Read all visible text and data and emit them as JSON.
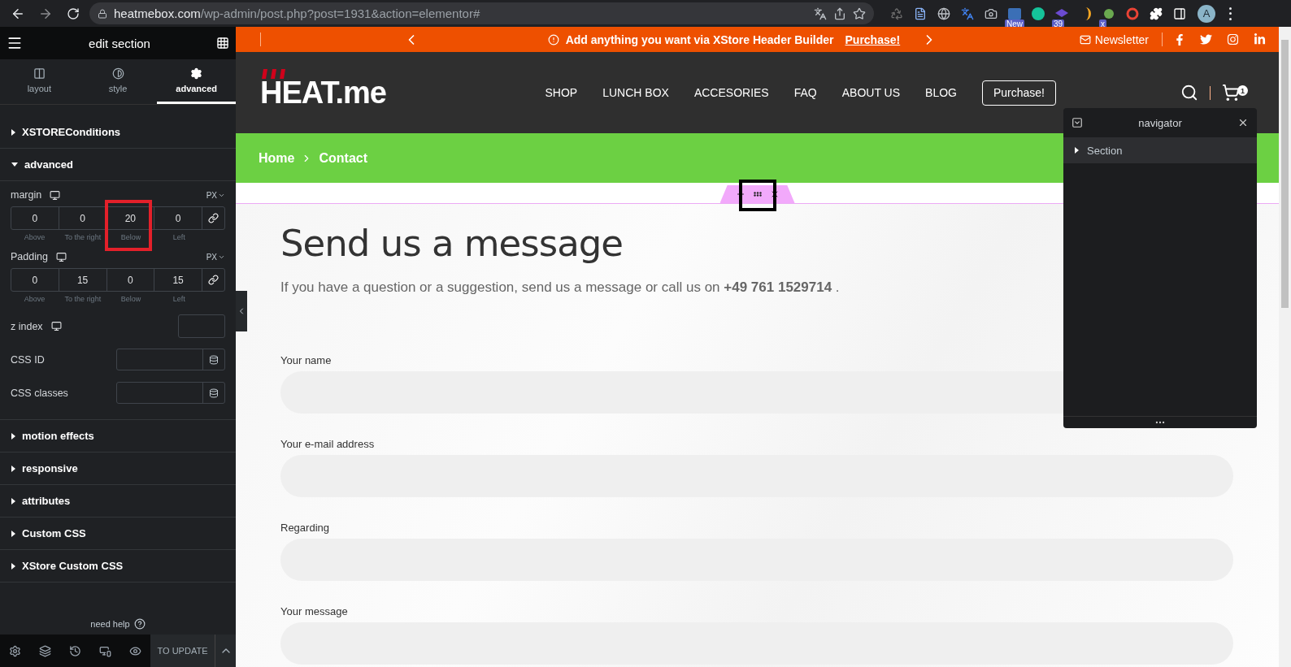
{
  "browser": {
    "host": "heatmebox.com",
    "path": "/wp-admin/post.php?post=1931&action=elementor#",
    "profile": "A",
    "extensions": [
      {
        "kind": "recycle"
      },
      {
        "kind": "document"
      },
      {
        "kind": "globe"
      },
      {
        "kind": "translate"
      },
      {
        "kind": "camera"
      },
      {
        "kind": "square",
        "badge": "New"
      },
      {
        "kind": "green"
      },
      {
        "kind": "hat",
        "badge": "39"
      },
      {
        "kind": "swirl"
      },
      {
        "kind": "planet",
        "badge": "x"
      },
      {
        "kind": "ring"
      },
      {
        "kind": "puzzle"
      },
      {
        "kind": "sidebar"
      }
    ]
  },
  "panel": {
    "title": "edit section",
    "tabs": [
      {
        "label": "layout",
        "kind": "layout",
        "selected": false
      },
      {
        "label": "style",
        "kind": "style",
        "selected": false
      },
      {
        "label": "advanced",
        "kind": "advanced",
        "selected": true
      }
    ],
    "sections": [
      {
        "title": "XSTOREConditions",
        "expanded": false
      },
      {
        "title": "advanced",
        "expanded": true,
        "controls": {
          "margin": {
            "label": "margin",
            "unit": "PX",
            "values": [
              {
                "value": "0",
                "label": "Above"
              },
              {
                "value": "0",
                "label": "To the right"
              },
              {
                "value": "20",
                "label": "Below"
              },
              {
                "value": "0",
                "label": "Left"
              }
            ]
          },
          "padding": {
            "label": "Padding",
            "unit": "PX",
            "values": [
              {
                "value": "0",
                "label": "Above"
              },
              {
                "value": "15",
                "label": "To the right"
              },
              {
                "value": "0",
                "label": "Below"
              },
              {
                "value": "15",
                "label": "Left"
              }
            ]
          },
          "z_index": {
            "label": "z index"
          },
          "css_id": {
            "label": "CSS ID"
          },
          "css_classes": {
            "label": "CSS classes"
          }
        }
      },
      {
        "title": "motion effects",
        "expanded": false
      },
      {
        "title": "responsive",
        "expanded": false
      },
      {
        "title": "attributes",
        "expanded": false
      },
      {
        "title": "Custom CSS",
        "expanded": false
      },
      {
        "title": "XStore Custom CSS",
        "expanded": false
      }
    ],
    "help": "need help",
    "update_button": "TO UPDATE"
  },
  "site": {
    "topbar": {
      "message": "Add anything you want via XStore Header Builder",
      "link": "Purchase!",
      "newsletter": "Newsletter"
    },
    "header": {
      "logo": "HEAT.me",
      "nav": [
        "SHOP",
        "LUNCH BOX",
        "ACCESORIES",
        "FAQ",
        "ABOUT US",
        "BLOG"
      ],
      "button": "Purchase!",
      "cart_count": "1"
    },
    "breadcrumb": [
      "Home",
      "Contact"
    ],
    "heading": "Send us a message",
    "intro": "If you have a question or a suggestion, send us a message or call us on **+49 761 1529714** .",
    "form_fields": [
      "Your name",
      "Your e-mail address",
      "Regarding",
      "Your message"
    ]
  },
  "navigator": {
    "title": "navigator",
    "items": [
      {
        "label": "Section",
        "expanded": false
      }
    ]
  }
}
